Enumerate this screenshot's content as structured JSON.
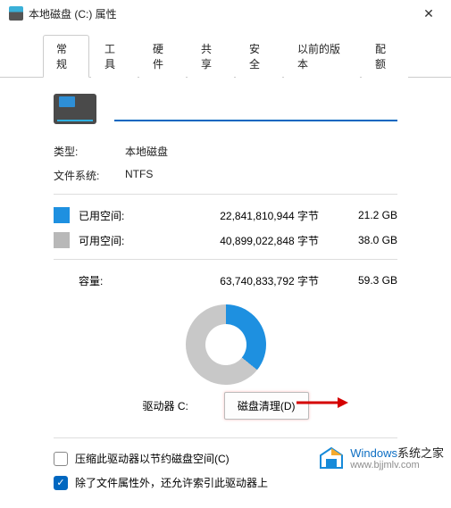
{
  "titlebar": {
    "title": "本地磁盘 (C:) 属性",
    "close": "✕"
  },
  "tabs": [
    {
      "label": "常规",
      "active": true
    },
    {
      "label": "工具",
      "active": false
    },
    {
      "label": "硬件",
      "active": false
    },
    {
      "label": "共享",
      "active": false
    },
    {
      "label": "安全",
      "active": false
    },
    {
      "label": "以前的版本",
      "active": false
    },
    {
      "label": "配额",
      "active": false
    }
  ],
  "drive_name_input": "",
  "info": {
    "type_label": "类型:",
    "type_value": "本地磁盘",
    "fs_label": "文件系统:",
    "fs_value": "NTFS"
  },
  "space": {
    "used_label": "已用空间:",
    "used_bytes": "22,841,810,944 字节",
    "used_gb": "21.2 GB",
    "free_label": "可用空间:",
    "free_bytes": "40,899,022,848 字节",
    "free_gb": "38.0 GB",
    "cap_label": "容量:",
    "cap_bytes": "63,740,833,792 字节",
    "cap_gb": "59.3 GB"
  },
  "chart_data": {
    "type": "pie",
    "title": "",
    "series": [
      {
        "name": "已用空间",
        "value": 21.2,
        "color": "#1e90e0"
      },
      {
        "name": "可用空间",
        "value": 38.0,
        "color": "#c8c8c8"
      }
    ],
    "unit": "GB",
    "total": 59.3
  },
  "drive_label": "驱动器 C:",
  "cleanup_button": "磁盘清理(D)",
  "compress_checkbox": {
    "checked": false,
    "label": "压缩此驱动器以节约磁盘空间(C)"
  },
  "index_checkbox": {
    "checked": true,
    "label": "除了文件属性外，还允许索引此驱动器上"
  },
  "watermark": {
    "brand_colored": "Windows",
    "brand_plain": "系统之家",
    "url": "www.bjjmlv.com"
  }
}
